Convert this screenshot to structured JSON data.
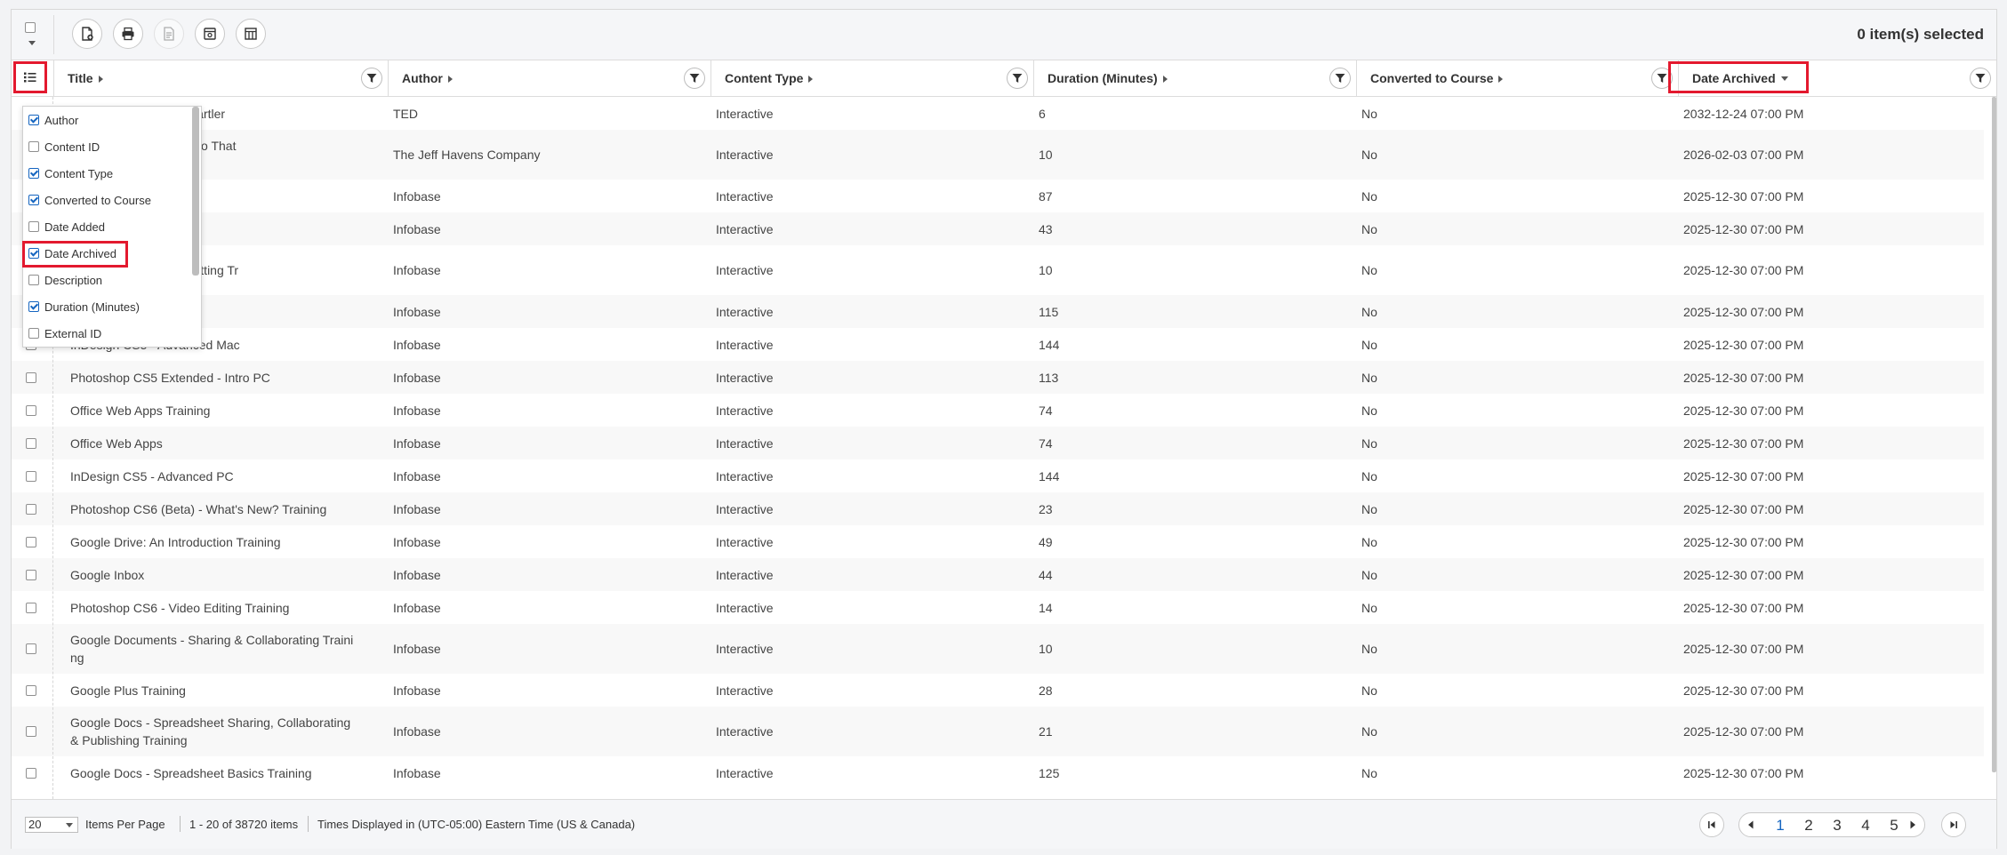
{
  "toolbar": {
    "selected_count": "0 item(s) selected",
    "buttons": [
      "add-content-icon",
      "print-icon",
      "report-icon",
      "archive-icon",
      "columns-icon"
    ]
  },
  "columns": {
    "title": "Title",
    "author": "Author",
    "content_type": "Content Type",
    "duration": "Duration (Minutes)",
    "converted": "Converted to Course",
    "date_archived": "Date Archived"
  },
  "column_chooser": {
    "items": [
      {
        "label": "Author",
        "checked": true
      },
      {
        "label": "Content ID",
        "checked": false
      },
      {
        "label": "Content Type",
        "checked": true
      },
      {
        "label": "Converted to Course",
        "checked": true
      },
      {
        "label": "Date Added",
        "checked": false
      },
      {
        "label": "Date Archived",
        "checked": true
      },
      {
        "label": "Description",
        "checked": false
      },
      {
        "label": "Duration (Minutes)",
        "checked": true
      },
      {
        "label": "External ID",
        "checked": false
      }
    ]
  },
  "rows": [
    {
      "title": "ne be made? | Dan Kwartler",
      "author": "TED",
      "content_type": "Interactive",
      "duration": "6",
      "converted": "No",
      "date_archived": "2032-12-24 07:00 PM"
    },
    {
      "title": "ce: How to Use Email So That\nHurt You",
      "author": "The Jeff Havens Company",
      "content_type": "Interactive",
      "duration": "10",
      "converted": "No",
      "date_archived": "2026-02-03 07:00 PM"
    },
    {
      "title": "",
      "author": "Infobase",
      "content_type": "Interactive",
      "duration": "87",
      "converted": "No",
      "date_archived": "2025-12-30 07:00 PM"
    },
    {
      "title": "e",
      "author": "Infobase",
      "content_type": "Interactive",
      "duration": "43",
      "converted": "No",
      "date_archived": "2025-12-30 07:00 PM"
    },
    {
      "title": "dsheet Editing & Formatting Tr",
      "author": "Infobase",
      "content_type": "Interactive",
      "duration": "10",
      "converted": "No",
      "date_archived": "2025-12-30 07:00 PM"
    },
    {
      "title": "",
      "author": "Infobase",
      "content_type": "Interactive",
      "duration": "115",
      "converted": "No",
      "date_archived": "2025-12-30 07:00 PM"
    },
    {
      "title": "InDesign CS5 - Advanced Mac",
      "author": "Infobase",
      "content_type": "Interactive",
      "duration": "144",
      "converted": "No",
      "date_archived": "2025-12-30 07:00 PM"
    },
    {
      "title": "Photoshop CS5 Extended - Intro PC",
      "author": "Infobase",
      "content_type": "Interactive",
      "duration": "113",
      "converted": "No",
      "date_archived": "2025-12-30 07:00 PM"
    },
    {
      "title": "Office Web Apps Training",
      "author": "Infobase",
      "content_type": "Interactive",
      "duration": "74",
      "converted": "No",
      "date_archived": "2025-12-30 07:00 PM"
    },
    {
      "title": "Office Web Apps",
      "author": "Infobase",
      "content_type": "Interactive",
      "duration": "74",
      "converted": "No",
      "date_archived": "2025-12-30 07:00 PM"
    },
    {
      "title": "InDesign CS5 - Advanced PC",
      "author": "Infobase",
      "content_type": "Interactive",
      "duration": "144",
      "converted": "No",
      "date_archived": "2025-12-30 07:00 PM"
    },
    {
      "title": "Photoshop CS6 (Beta) - What's New? Training",
      "author": "Infobase",
      "content_type": "Interactive",
      "duration": "23",
      "converted": "No",
      "date_archived": "2025-12-30 07:00 PM"
    },
    {
      "title": "Google Drive: An Introduction Training",
      "author": "Infobase",
      "content_type": "Interactive",
      "duration": "49",
      "converted": "No",
      "date_archived": "2025-12-30 07:00 PM"
    },
    {
      "title": "Google Inbox",
      "author": "Infobase",
      "content_type": "Interactive",
      "duration": "44",
      "converted": "No",
      "date_archived": "2025-12-30 07:00 PM"
    },
    {
      "title": "Photoshop CS6 - Video Editing Training",
      "author": "Infobase",
      "content_type": "Interactive",
      "duration": "14",
      "converted": "No",
      "date_archived": "2025-12-30 07:00 PM"
    },
    {
      "title": "Google Documents - Sharing & Collaborating Traini\nng",
      "author": "Infobase",
      "content_type": "Interactive",
      "duration": "10",
      "converted": "No",
      "date_archived": "2025-12-30 07:00 PM"
    },
    {
      "title": "Google Plus Training",
      "author": "Infobase",
      "content_type": "Interactive",
      "duration": "28",
      "converted": "No",
      "date_archived": "2025-12-30 07:00 PM"
    },
    {
      "title": "Google Docs - Spreadsheet Sharing, Collaborating\n& Publishing Training",
      "author": "Infobase",
      "content_type": "Interactive",
      "duration": "21",
      "converted": "No",
      "date_archived": "2025-12-30 07:00 PM"
    },
    {
      "title": "Google Docs - Spreadsheet Basics Training",
      "author": "Infobase",
      "content_type": "Interactive",
      "duration": "125",
      "converted": "No",
      "date_archived": "2025-12-30 07:00 PM"
    }
  ],
  "footer": {
    "per_page_value": "20",
    "per_page_label": "Items Per Page",
    "range": "1 - 20 of 38720 items",
    "timezone": "Times Displayed in (UTC-05:00) Eastern Time (US & Canada)",
    "pages": [
      "1",
      "2",
      "3",
      "4",
      "5"
    ],
    "current_page": "1"
  },
  "colors": {
    "highlight": "#e3192e",
    "accent": "#1565c0"
  }
}
